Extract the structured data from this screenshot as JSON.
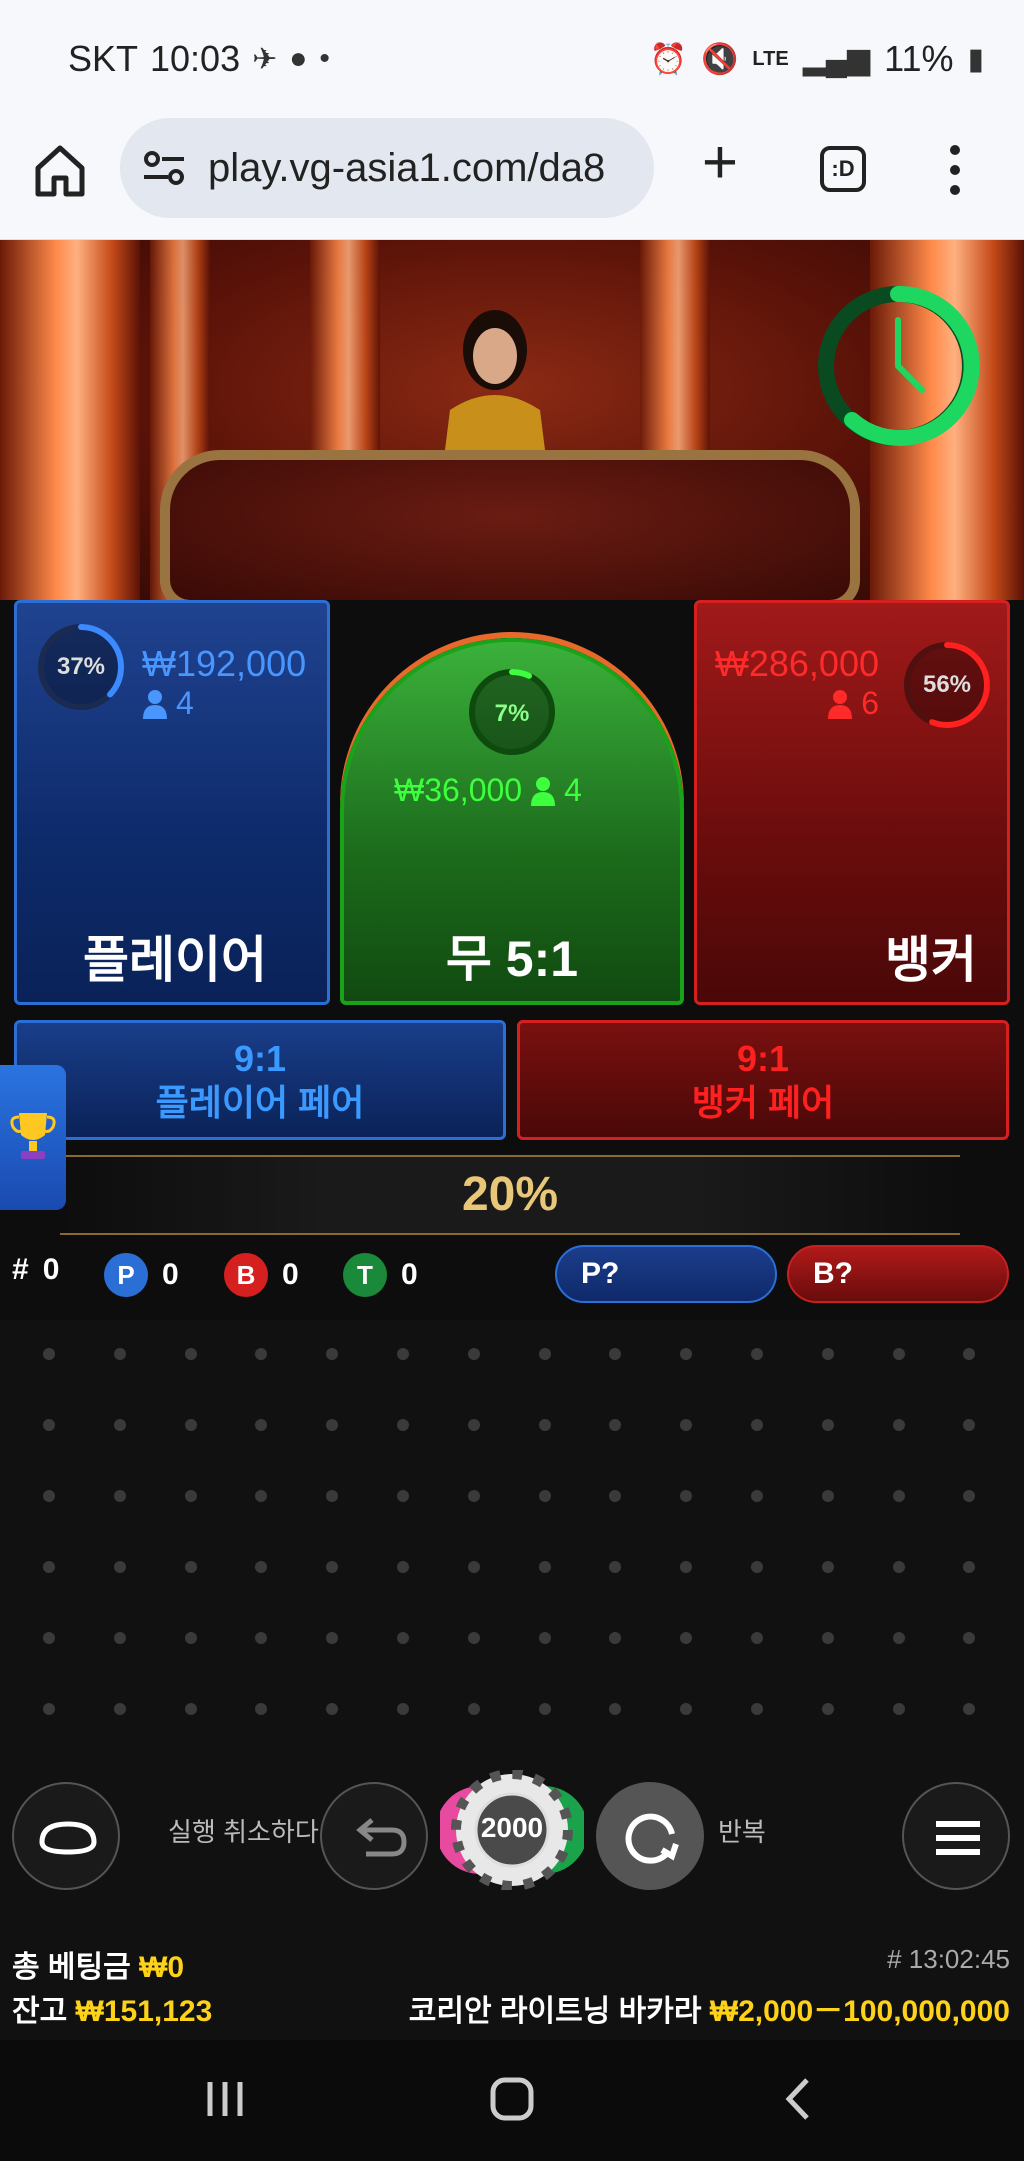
{
  "status_bar": {
    "carrier": "SKT",
    "time": "10:03",
    "network": "LTE",
    "battery": "11%"
  },
  "browser": {
    "url": "play.vg-asia1.com/da8",
    "tab_label": ":D"
  },
  "game": {
    "player": {
      "label": "플레이어",
      "percent": "37%",
      "percent_value": 0.37,
      "amount": "₩192,000",
      "bettors": "4"
    },
    "tie": {
      "label": "무 5:1",
      "percent": "7%",
      "percent_value": 0.07,
      "amount": "₩36,000",
      "bettors": "4"
    },
    "banker": {
      "label": "뱅커",
      "percent": "56%",
      "percent_value": 0.56,
      "amount": "₩286,000",
      "bettors": "6"
    },
    "player_pair": {
      "odds": "9:1",
      "label": "플레이어 페어"
    },
    "banker_pair": {
      "odds": "9:1",
      "label": "뱅커 페어"
    },
    "lightning_percent": "20%"
  },
  "stats": {
    "rounds_label": "#",
    "rounds": "0",
    "p_badge": "P",
    "p_count": "0",
    "b_badge": "B",
    "b_count": "0",
    "t_badge": "T",
    "t_count": "0",
    "predict_player": "P?",
    "predict_banker": "B?"
  },
  "controls": {
    "undo_label": "실행 취소하다",
    "chip_value": "2000",
    "repeat_label": "반복"
  },
  "footer": {
    "total_bet_label": "총 베팅금",
    "total_bet": "₩0",
    "balance_label": "잔고",
    "balance": "₩151,123",
    "round_id": "# 13:02:45",
    "table_name": "코리안 라이트닝 바카라",
    "limits": "₩2,000－100,000,000"
  },
  "colors": {
    "player": "#2b6fd6",
    "banker": "#d62020",
    "tie": "#1aa31a",
    "accent_yellow": "#ffd21a",
    "timer": "#1ed760"
  },
  "icons": [
    "home-icon",
    "tune-icon",
    "plus-icon",
    "tabs-icon",
    "more-vert-icon",
    "clock-icon",
    "person-icon",
    "trophy-icon",
    "oval-table-icon",
    "undo-icon",
    "repeat-icon",
    "menu-icon",
    "recents-icon",
    "home-nav-icon",
    "back-icon"
  ]
}
